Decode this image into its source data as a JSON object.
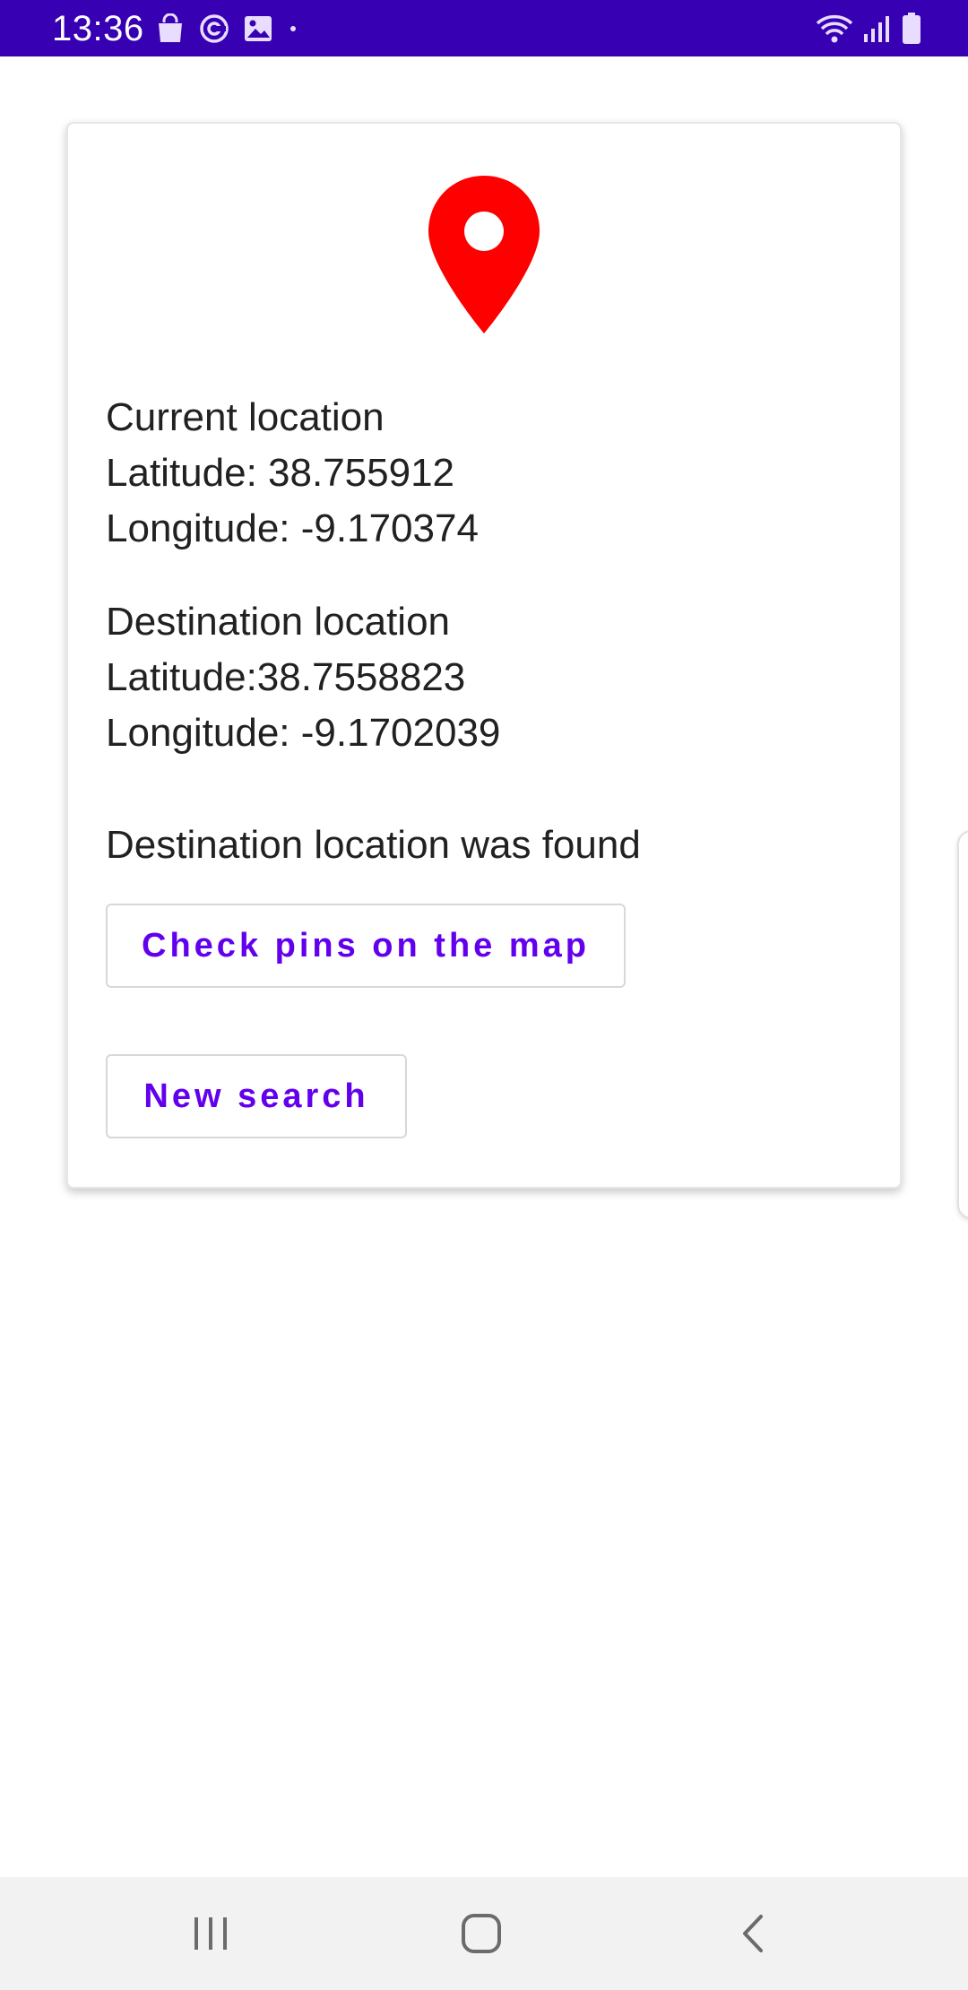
{
  "status_bar": {
    "time": "13:36",
    "background_color": "#3700b3",
    "left_icons": [
      "shopping-bag-icon",
      "sync-icon",
      "gallery-icon",
      "dot-icon"
    ],
    "right_icons": [
      "wifi-icon",
      "signal-icon",
      "battery-icon"
    ]
  },
  "card": {
    "pin_icon": "location-pin-icon",
    "pin_color": "#ff0000",
    "current": {
      "title": "Current location",
      "latitude": "Latitude: 38.755912",
      "longitude": "Longitude: -9.170374"
    },
    "destination": {
      "title": "Destination location",
      "latitude": "Latitude:38.7558823",
      "longitude": "Longitude: -9.1702039"
    },
    "status_message": "Destination location was found",
    "check_pins_button": "Check pins on the map",
    "new_search_button": "New search",
    "accent_color": "#6200ee"
  },
  "nav_bar": {
    "buttons": [
      "recent-apps-icon",
      "home-icon",
      "back-icon"
    ]
  }
}
